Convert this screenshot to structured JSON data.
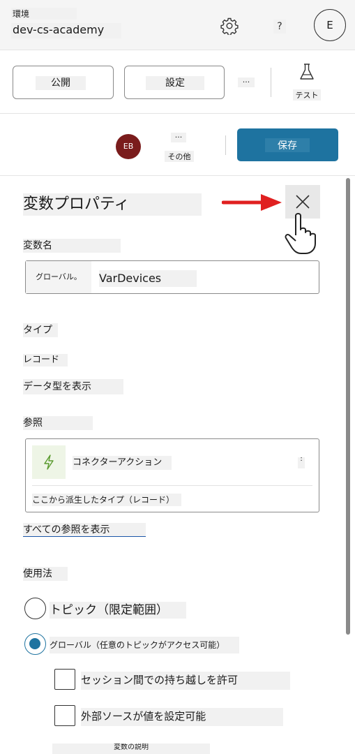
{
  "header": {
    "environment_label": "環境",
    "environment_name": "dev-cs-academy",
    "help_label": "?",
    "user_initial": "E"
  },
  "toolbar": {
    "publish_label": "公開",
    "settings_label": "設定",
    "more_label": "...",
    "test_label": "テスト"
  },
  "saverow": {
    "avatar_initials": "EB",
    "more_dots": "...",
    "more_label": "その他",
    "save_label": "保存",
    "save_color": "#1e73a0",
    "avatar_color": "#7a1c1c"
  },
  "panel": {
    "title": "変数プロパティ",
    "variable_name_label": "変数名",
    "variable_scope": "グローバル。",
    "variable_name_value": "VarDevices",
    "type_label": "タイプ",
    "type_value": "レコード",
    "show_data_type": "データ型を表示",
    "reference_label": "参照",
    "reference_item": "コネクターアクション",
    "reference_menu": ":",
    "reference_derived": "ここから派生したタイプ（レコード）",
    "show_all_references": "すべての参照を表示",
    "usage_label": "使用法",
    "usage_options": [
      {
        "label": "トピック（限定範囲）",
        "selected": false
      },
      {
        "label": "グローバル（任意のトピックがアクセス可能）",
        "selected": true
      }
    ],
    "checkboxes": [
      {
        "label": "セッション間での持ち越しを許可",
        "checked": false
      },
      {
        "label": "外部ソースが値を設定可能",
        "checked": false
      }
    ],
    "description_label": "変数の説明"
  },
  "annotation": {
    "arrow_color": "#e02020",
    "icons": [
      "gear-icon",
      "flask-icon",
      "close-icon",
      "lightning-icon",
      "pointer-hand-icon",
      "red-arrow"
    ]
  }
}
